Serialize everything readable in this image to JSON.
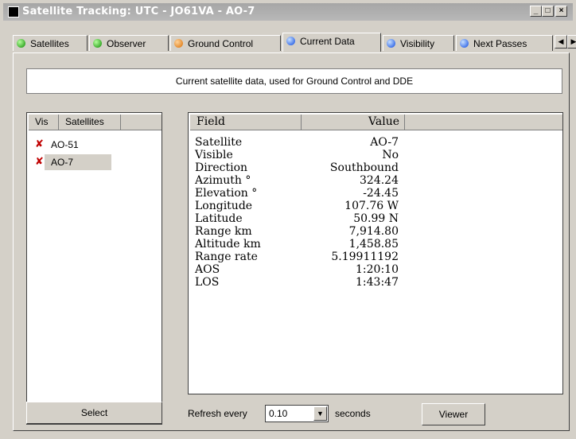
{
  "window": {
    "title": "Satellite Tracking: UTC - JO61VA - AO-7",
    "controls": {
      "minimize": "_",
      "maximize": "□",
      "close": "×"
    }
  },
  "tabs": [
    {
      "label": "Satellites",
      "icon": "green-dot-icon",
      "color": "#0b8a00"
    },
    {
      "label": "Observer",
      "icon": "green-dot-icon",
      "color": "#0b8a00"
    },
    {
      "label": "Ground Control",
      "icon": "orange-dot-icon",
      "color": "#d96d00"
    },
    {
      "label": "Current Data",
      "icon": "blue-dot-icon",
      "color": "#0b48e0",
      "active": true
    },
    {
      "label": "Visibility",
      "icon": "blue-dot-icon",
      "color": "#0b48e0"
    },
    {
      "label": "Next Passes",
      "icon": "blue-dot-icon",
      "color": "#0b48e0"
    }
  ],
  "tab_scroll": {
    "left": "◀",
    "right": "▶"
  },
  "info_text": "Current satellite data, used for Ground Control and DDE",
  "satellite_list": {
    "columns": [
      "Vis",
      "Satellites"
    ],
    "rows": [
      {
        "vis": "✘",
        "name": "AO-51",
        "selected": false
      },
      {
        "vis": "✘",
        "name": "AO-7",
        "selected": true
      }
    ]
  },
  "data_table": {
    "columns": [
      "Field",
      "Value"
    ],
    "rows": [
      {
        "field": "Satellite",
        "value": "AO-7"
      },
      {
        "field": "Visible",
        "value": "No"
      },
      {
        "field": "Direction",
        "value": "Southbound"
      },
      {
        "field": "Azimuth °",
        "value": "324.24"
      },
      {
        "field": "Elevation °",
        "value": "-24.45"
      },
      {
        "field": "Longitude",
        "value": "107.76 W"
      },
      {
        "field": "Latitude",
        "value": "50.99 N"
      },
      {
        "field": "Range km",
        "value": "7,914.80"
      },
      {
        "field": "Altitude km",
        "value": "1,458.85"
      },
      {
        "field": "Range rate",
        "value": "5.19911192"
      },
      {
        "field": "AOS",
        "value": "1:20:10"
      },
      {
        "field": "LOS",
        "value": "1:43:47"
      }
    ]
  },
  "bottom": {
    "select_label": "Select",
    "refresh_label": "Refresh every",
    "refresh_value": "0.10",
    "seconds_label": "seconds",
    "viewer_label": "Viewer"
  }
}
